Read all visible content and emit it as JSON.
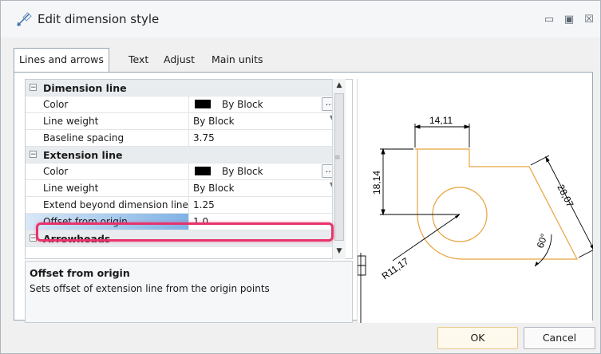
{
  "window": {
    "title": "Edit dimension style",
    "controls": [
      "minimize",
      "restore",
      "close"
    ]
  },
  "tabs": [
    {
      "label": "Lines and arrows",
      "active": true
    },
    {
      "label": "Text",
      "active": false
    },
    {
      "label": "Adjust",
      "active": false
    },
    {
      "label": "Main units",
      "active": false
    }
  ],
  "properties": {
    "dimension_line": {
      "label": "Dimension line",
      "color": {
        "name": "Color",
        "value": "By Block"
      },
      "line_weight": {
        "name": "Line weight",
        "value": "By Block"
      },
      "baseline_spacing": {
        "name": "Baseline spacing",
        "value": "3.75"
      }
    },
    "extension_line": {
      "label": "Extension line",
      "color": {
        "name": "Color",
        "value": "By Block"
      },
      "line_weight": {
        "name": "Line weight",
        "value": "By Block"
      },
      "extend_beyond": {
        "name": "Extend beyond dimension line",
        "value": "1.25"
      },
      "offset_from_origin": {
        "name": "Offset from origin",
        "value": "1.0"
      }
    },
    "arrowheads": {
      "label": "Arrowheads"
    }
  },
  "description": {
    "title": "Offset from origin",
    "text": "Sets offset of extension line from the origin points"
  },
  "preview": {
    "dim_top": "14,11",
    "dim_left": "18,14",
    "dim_right": "28,07",
    "dim_angle": "60°",
    "dim_radius": "R11,17",
    "shape_color": "#e8a33c",
    "dim_color": "#000000"
  },
  "buttons": {
    "ok": "OK",
    "cancel": "Cancel"
  },
  "colors": {
    "highlight": "#e8336c",
    "selection": "#7fb2e5"
  }
}
